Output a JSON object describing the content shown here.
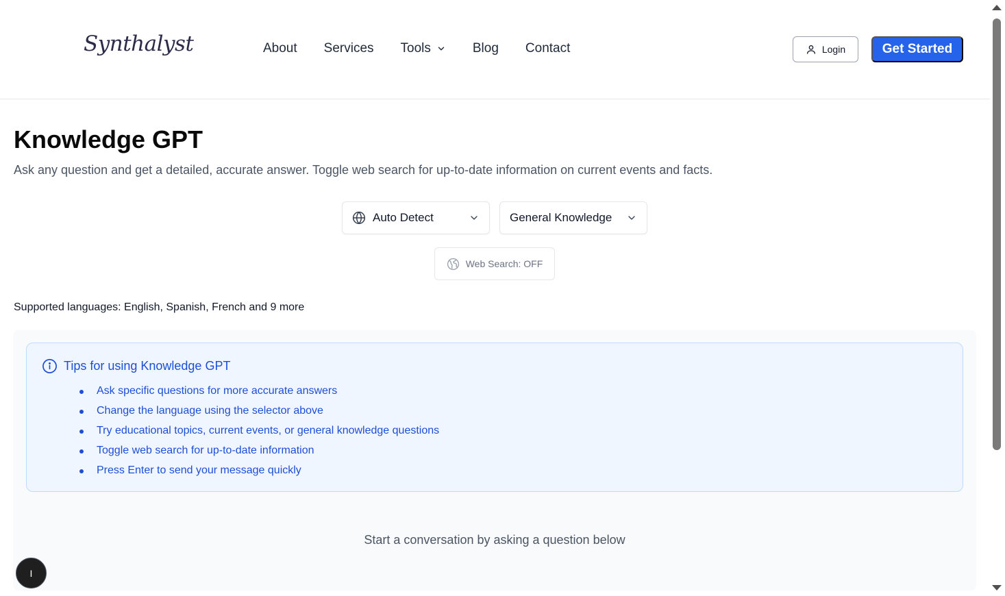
{
  "header": {
    "logo": "Synthalyst",
    "nav": [
      "About",
      "Services",
      "Tools",
      "Blog",
      "Contact"
    ],
    "login_label": "Login",
    "cta_label": "Get Started"
  },
  "main": {
    "title": "Knowledge GPT",
    "subtitle": "Ask any question and get a detailed, accurate answer. Toggle web search for up-to-date information on current events and facts.",
    "language_select": "Auto Detect",
    "mode_select": "General Knowledge",
    "web_search_label": "Web Search: OFF",
    "supported_languages": "Supported languages: English, Spanish, French and 9 more"
  },
  "tips": {
    "title": "Tips for using Knowledge GPT",
    "items": [
      "Ask specific questions for more accurate answers",
      "Change the language using the selector above",
      "Try educational topics, current events, or general knowledge questions",
      "Toggle web search for up-to-date information",
      "Press Enter to send your message quickly"
    ]
  },
  "chat": {
    "empty_message": "Start a conversation by asking a question below"
  },
  "floating_button_label": "I",
  "colors": {
    "accent": "#2563eb",
    "tips_bg": "#eff6ff",
    "tips_text": "#1d4ed8"
  }
}
